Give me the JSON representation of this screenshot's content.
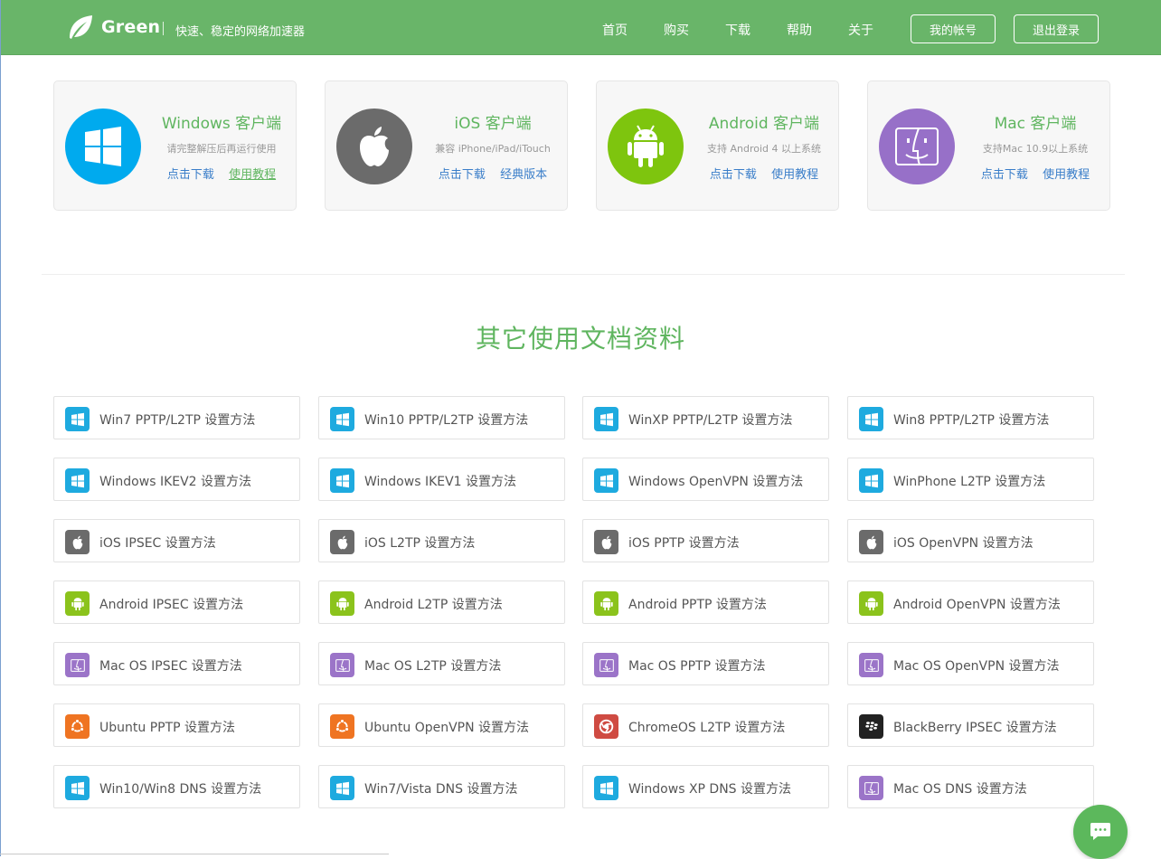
{
  "header": {
    "brand": "Green",
    "tagline": "快速、稳定的网络加速器",
    "nav": [
      "首页",
      "购买",
      "下载",
      "帮助",
      "关于"
    ],
    "account_button": "我的帐号",
    "logout_button": "退出登录"
  },
  "clients": [
    {
      "title": "Windows 客户端",
      "subtitle": "请完整解压后再运行使用",
      "links": [
        "点击下载",
        "使用教程"
      ],
      "icon": "windows-icon",
      "color": "#00aaee"
    },
    {
      "title": "iOS 客户端",
      "subtitle": "兼容 iPhone/iPad/iTouch",
      "links": [
        "点击下载",
        "经典版本"
      ],
      "icon": "apple-icon",
      "color": "#6b6b6b"
    },
    {
      "title": "Android 客户端",
      "subtitle": "支持 Android 4 以上系统",
      "links": [
        "点击下载",
        "使用教程"
      ],
      "icon": "android-icon",
      "color": "#7ec50e"
    },
    {
      "title": "Mac 客户端",
      "subtitle": "支持Mac 10.9以上系统",
      "links": [
        "点击下载",
        "使用教程"
      ],
      "icon": "finder-icon",
      "color": "#9770c8"
    }
  ],
  "docs_section": {
    "title": "其它使用文档资料",
    "items": [
      {
        "label": "Win7 PPTP/L2TP 设置方法",
        "icon": "windows-icon",
        "color": "#1eaadf"
      },
      {
        "label": "Win10 PPTP/L2TP 设置方法",
        "icon": "windows-icon",
        "color": "#1eaadf"
      },
      {
        "label": "WinXP PPTP/L2TP 设置方法",
        "icon": "windows-icon",
        "color": "#1eaadf"
      },
      {
        "label": "Win8 PPTP/L2TP 设置方法",
        "icon": "windows-icon",
        "color": "#1eaadf"
      },
      {
        "label": "Windows IKEV2 设置方法",
        "icon": "windows-icon",
        "color": "#1eaadf"
      },
      {
        "label": "Windows IKEV1 设置方法",
        "icon": "windows-icon",
        "color": "#1eaadf"
      },
      {
        "label": "Windows OpenVPN 设置方法",
        "icon": "windows-icon",
        "color": "#1eaadf"
      },
      {
        "label": "WinPhone L2TP 设置方法",
        "icon": "windows-icon",
        "color": "#1eaadf"
      },
      {
        "label": "iOS IPSEC 设置方法",
        "icon": "apple-icon",
        "color": "#6b6b6b"
      },
      {
        "label": "iOS L2TP 设置方法",
        "icon": "apple-icon",
        "color": "#6b6b6b"
      },
      {
        "label": "iOS PPTP 设置方法",
        "icon": "apple-icon",
        "color": "#6b6b6b"
      },
      {
        "label": "iOS OpenVPN 设置方法",
        "icon": "apple-icon",
        "color": "#6b6b6b"
      },
      {
        "label": "Android IPSEC 设置方法",
        "icon": "android-icon",
        "color": "#8bc31c"
      },
      {
        "label": "Android L2TP 设置方法",
        "icon": "android-icon",
        "color": "#8bc31c"
      },
      {
        "label": "Android PPTP 设置方法",
        "icon": "android-icon",
        "color": "#8bc31c"
      },
      {
        "label": "Android OpenVPN 设置方法",
        "icon": "android-icon",
        "color": "#8bc31c"
      },
      {
        "label": "Mac OS IPSEC 设置方法",
        "icon": "finder-icon",
        "color": "#9b74c8"
      },
      {
        "label": "Mac OS L2TP 设置方法",
        "icon": "finder-icon",
        "color": "#9b74c8"
      },
      {
        "label": "Mac OS PPTP 设置方法",
        "icon": "finder-icon",
        "color": "#9b74c8"
      },
      {
        "label": "Mac OS OpenVPN 设置方法",
        "icon": "finder-icon",
        "color": "#9b74c8"
      },
      {
        "label": "Ubuntu PPTP 设置方法",
        "icon": "ubuntu-icon",
        "color": "#ef7422"
      },
      {
        "label": "Ubuntu OpenVPN 设置方法",
        "icon": "ubuntu-icon",
        "color": "#ef7422"
      },
      {
        "label": "ChromeOS L2TP 设置方法",
        "icon": "chrome-icon",
        "color": "#cf4b42"
      },
      {
        "label": "BlackBerry IPSEC 设置方法",
        "icon": "blackberry-icon",
        "color": "#222222"
      },
      {
        "label": "Win10/Win8 DNS 设置方法",
        "icon": "windows-icon",
        "color": "#1eaadf"
      },
      {
        "label": "Win7/Vista DNS 设置方法",
        "icon": "windows-icon",
        "color": "#1eaadf"
      },
      {
        "label": "Windows XP DNS 设置方法",
        "icon": "windows-icon",
        "color": "#1eaadf"
      },
      {
        "label": "Mac OS DNS 设置方法",
        "icon": "finder-icon",
        "color": "#9b74c8"
      }
    ]
  },
  "chat_button": {
    "icon": "chat-icon",
    "color": "#5cb85c"
  },
  "accent_color": "#69b569"
}
